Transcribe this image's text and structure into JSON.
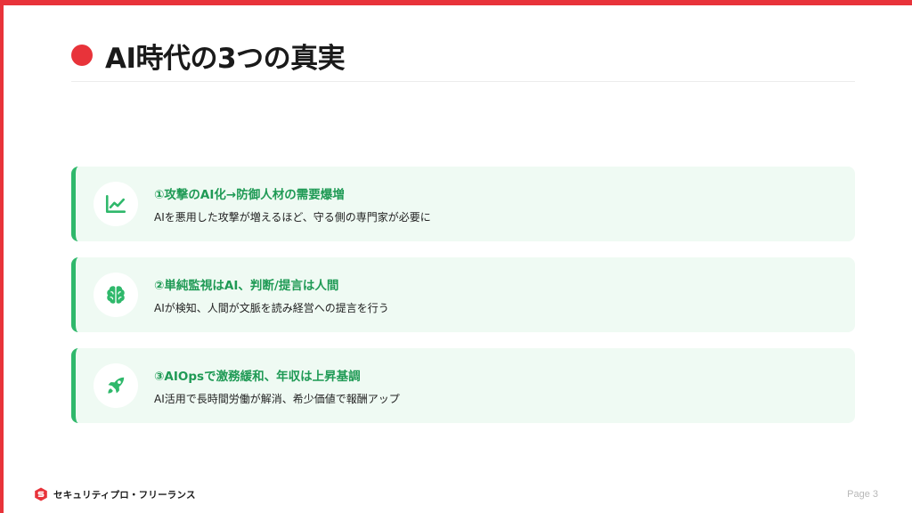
{
  "slide": {
    "title": "AI時代の3つの真実",
    "accent_color": "#e8333a",
    "card_accent_color": "#2fb86b",
    "heading_color": "#1f9a55"
  },
  "cards": [
    {
      "icon": "line-chart-icon",
      "heading": "①攻撃のAI化→防御人材の需要爆増",
      "description": "AIを悪用した攻撃が増えるほど、守る側の専門家が必要に"
    },
    {
      "icon": "brain-icon",
      "heading": "②単純監視はAI、判断/提言は人間",
      "description": "AIが検知、人間が文脈を読み経営への提言を行う"
    },
    {
      "icon": "rocket-icon",
      "heading": "③AIOpsで激務緩和、年収は上昇基調",
      "description": "AI活用で長時間労働が解消、希少価値で報酬アップ"
    }
  ],
  "footer": {
    "brand": "セキュリティプロ・フリーランス",
    "brand_icon": "shield-logo-icon",
    "page": "Page 3"
  }
}
